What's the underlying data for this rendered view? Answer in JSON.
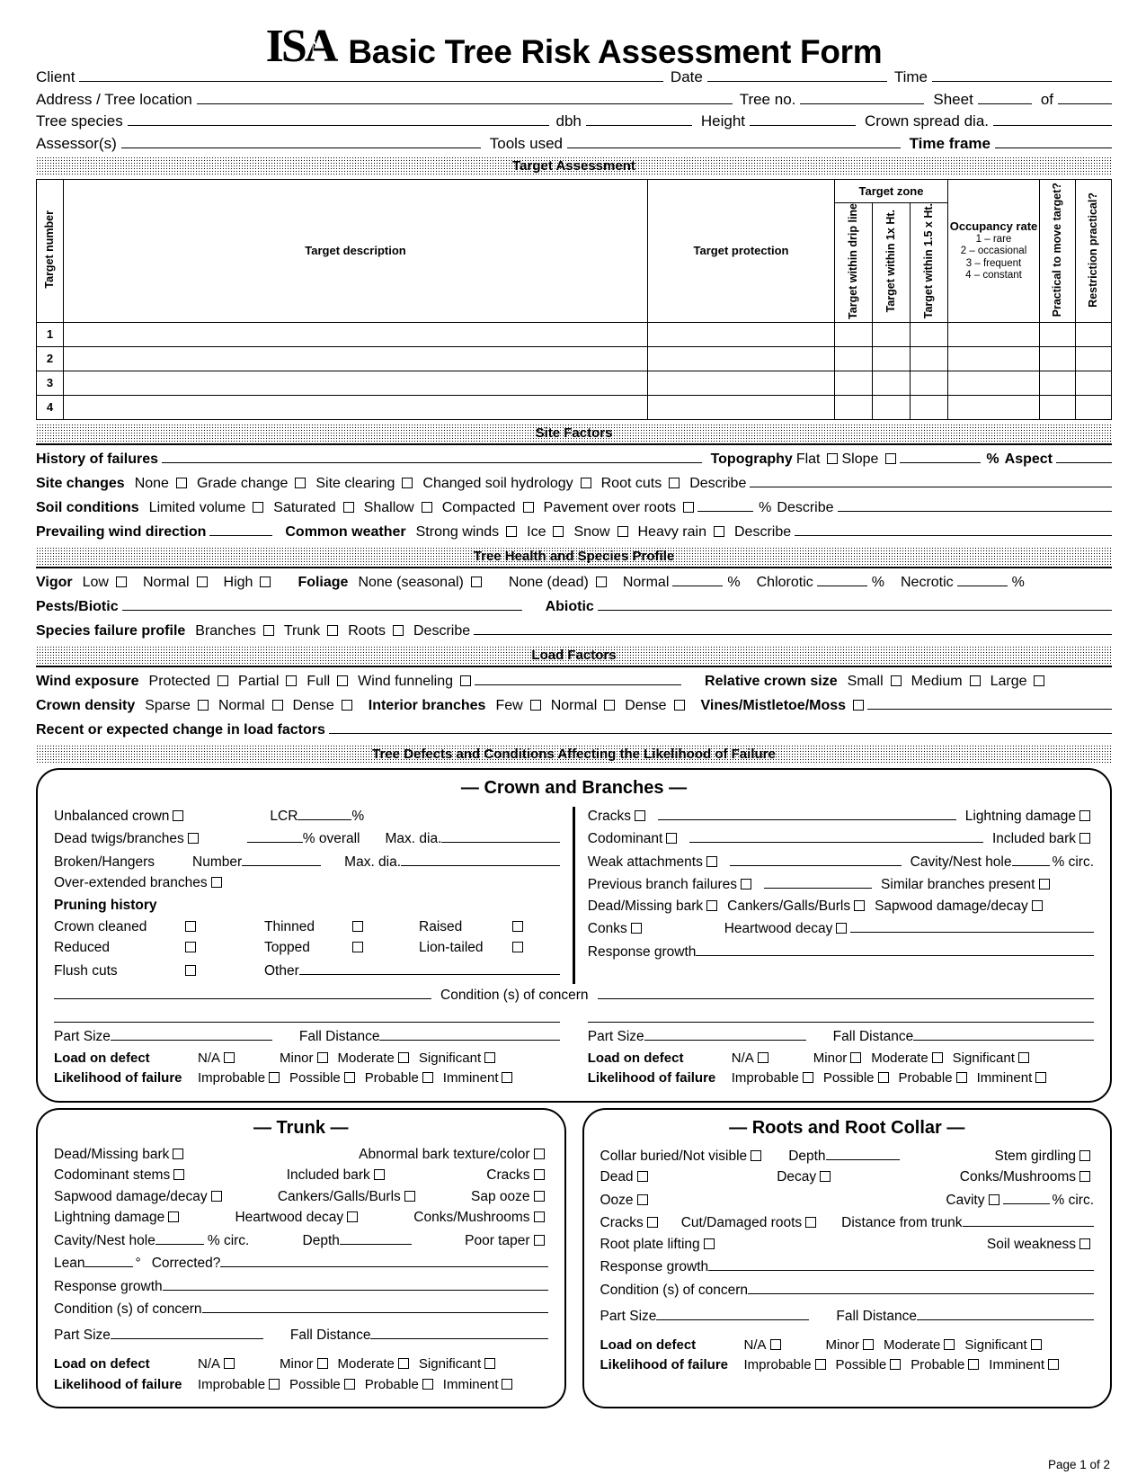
{
  "header": {
    "logo": "ISA",
    "title": "Basic Tree Risk Assessment Form",
    "client_label": "Client",
    "date_label": "Date",
    "time_label": "Time",
    "address_label": "Address / Tree location",
    "tree_no_label": "Tree no.",
    "sheet_label": "Sheet",
    "of_label": "of",
    "tree_species_label": "Tree species",
    "dbh_label": "dbh",
    "height_label": "Height",
    "crown_spread_label": "Crown spread dia.",
    "assessors_label": "Assessor(s)",
    "tools_used_label": "Tools used",
    "time_frame_label": "Time frame"
  },
  "sections": {
    "target_assessment": "Target Assessment",
    "site_factors": "Site Factors",
    "tree_health": "Tree Health and Species Profile",
    "load_factors": "Load Factors",
    "tree_defects": "Tree Defects and Conditions Affecting the Likelihood of Failure"
  },
  "target_table": {
    "col_target_number": "Target number",
    "col_target_description": "Target description",
    "col_target_protection": "Target protection",
    "group_target_zone": "Target zone",
    "col_zone_drip": "Target within drip line",
    "col_zone_1x": "Target within 1x Ht.",
    "col_zone_15x": "Target within 1.5 x Ht.",
    "col_occupancy_title": "Occupancy rate",
    "occupancy_legend": [
      "1 – rare",
      "2 – occasional",
      "3 – frequent",
      "4 – constant"
    ],
    "col_practical_move": "Practical to move target?",
    "col_restriction": "Restriction practical?",
    "rows": [
      "1",
      "2",
      "3",
      "4"
    ]
  },
  "site_factors": {
    "history_label": "History of failures",
    "topography_label": "Topography",
    "topography_flat": "Flat",
    "topography_slope": "Slope",
    "percent": "%",
    "aspect_label": "Aspect",
    "site_changes_label": "Site changes",
    "site_changes_options": [
      "None",
      "Grade change",
      "Site clearing",
      "Changed soil hydrology",
      "Root cuts"
    ],
    "describe": "Describe",
    "soil_conditions_label": "Soil conditions",
    "soil_options": [
      "Limited volume",
      "Saturated",
      "Shallow",
      "Compacted",
      "Pavement over roots"
    ],
    "wind_direction_label": "Prevailing wind direction",
    "common_weather_label": "Common weather",
    "weather_options": [
      "Strong winds",
      "Ice",
      "Snow",
      "Heavy rain"
    ]
  },
  "tree_health": {
    "vigor_label": "Vigor",
    "vigor_options": [
      "Low",
      "Normal",
      "High"
    ],
    "foliage_label": "Foliage",
    "foliage_none_seasonal": "None (seasonal)",
    "foliage_none_dead": "None (dead)",
    "foliage_normal": "Normal",
    "foliage_chlorotic": "Chlorotic",
    "foliage_necrotic": "Necrotic",
    "percent": "%",
    "pests_label": "Pests/Biotic",
    "abiotic_label": "Abiotic",
    "species_failure_label": "Species failure profile",
    "species_failure_options": [
      "Branches",
      "Trunk",
      "Roots"
    ],
    "describe": "Describe"
  },
  "load_factors": {
    "wind_exposure_label": "Wind exposure",
    "wind_exposure_options": [
      "Protected",
      "Partial",
      "Full"
    ],
    "wind_funneling": "Wind funneling",
    "relative_crown_size_label": "Relative crown size",
    "relative_crown_options": [
      "Small",
      "Medium",
      "Large"
    ],
    "crown_density_label": "Crown density",
    "crown_density_options": [
      "Sparse",
      "Normal",
      "Dense"
    ],
    "interior_branches_label": "Interior branches",
    "interior_branches_options": [
      "Few",
      "Normal",
      "Dense"
    ],
    "vines_label": "Vines/Mistletoe/Moss",
    "recent_change_label": "Recent or expected change in load factors"
  },
  "crown": {
    "title": "— Crown and Branches —",
    "unbalanced_crown": "Unbalanced crown",
    "lcr": "LCR",
    "percent": "%",
    "dead_twigs": "Dead twigs/branches",
    "percent_overall": "% overall",
    "max_dia": "Max. dia.",
    "broken_hangers": "Broken/Hangers",
    "number": "Number",
    "over_extended": "Over-extended branches",
    "pruning_history": "Pruning history",
    "pruning": [
      [
        "Crown cleaned",
        "Thinned",
        "Raised"
      ],
      [
        "Reduced",
        "Topped",
        "Lion-tailed"
      ]
    ],
    "flush_cuts": "Flush cuts",
    "other": "Other",
    "cracks": "Cracks",
    "lightning_damage": "Lightning damage",
    "codominant": "Codominant",
    "included_bark": "Included bark",
    "weak_attachments": "Weak attachments",
    "cavity_nest_hole": "Cavity/Nest hole",
    "pct_circ": "% circ.",
    "previous_branch_failures": "Previous branch failures",
    "similar_branches": "Similar branches present",
    "dead_missing_bark": "Dead/Missing bark",
    "cankers": "Cankers/Galls/Burls",
    "sapwood": "Sapwood damage/decay",
    "conks": "Conks",
    "heartwood_decay": "Heartwood decay",
    "response_growth": "Response growth",
    "conditions_of_concern": "Condition (s) of concern"
  },
  "trunk": {
    "title": "— Trunk —",
    "dead_missing_bark": "Dead/Missing bark",
    "abnormal_bark": "Abnormal bark texture/color",
    "codominant_stems": "Codominant stems",
    "included_bark": "Included bark",
    "cracks": "Cracks",
    "sapwood": "Sapwood damage/decay",
    "cankers": "Cankers/Galls/Burls",
    "sap_ooze": "Sap ooze",
    "lightning_damage": "Lightning damage",
    "heartwood_decay": "Heartwood decay",
    "conks": "Conks/Mushrooms",
    "cavity_nest_hole": "Cavity/Nest hole",
    "pct_circ": "% circ.",
    "depth": "Depth",
    "poor_taper": "Poor taper",
    "lean": "Lean",
    "degree": "°",
    "corrected": "Corrected?",
    "response_growth": "Response growth",
    "conditions_of_concern": "Condition (s) of concern"
  },
  "roots": {
    "title": "— Roots and Root Collar —",
    "collar_buried": "Collar buried/Not visible",
    "depth": "Depth",
    "stem_girdling": "Stem girdling",
    "dead": "Dead",
    "decay": "Decay",
    "conks": "Conks/Mushrooms",
    "ooze": "Ooze",
    "cavity": "Cavity",
    "pct_circ": "% circ.",
    "cracks": "Cracks",
    "cut_damaged_roots": "Cut/Damaged roots",
    "distance_from_trunk": "Distance from trunk",
    "root_plate_lifting": "Root plate lifting",
    "soil_weakness": "Soil weakness",
    "response_growth": "Response growth",
    "conditions_of_concern": "Condition (s) of concern"
  },
  "ratings": {
    "part_size": "Part Size",
    "fall_distance": "Fall Distance",
    "load_on_defect": "Load on defect",
    "load_options": [
      "N/A",
      "Minor",
      "Moderate",
      "Significant"
    ],
    "likelihood_label": "Likelihood of failure",
    "likelihood_options": [
      "Improbable",
      "Possible",
      "Probable",
      "Imminent"
    ]
  },
  "footer": {
    "page": "Page 1 of 2"
  }
}
